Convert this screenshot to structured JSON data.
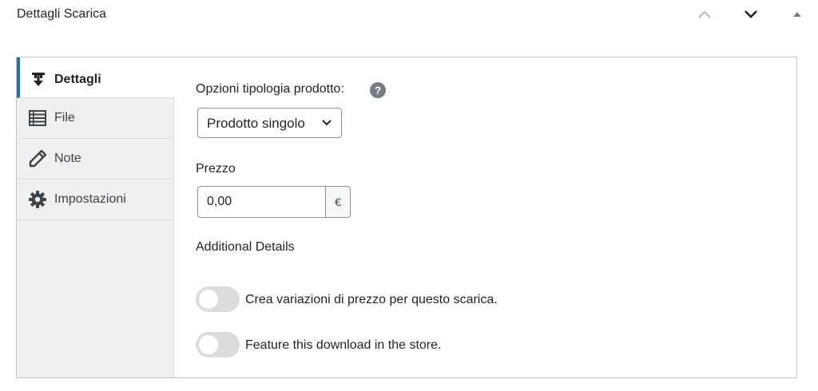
{
  "metabox": {
    "title": "Dettagli Scarica",
    "controls": {
      "move_up_icon": "chevron-up-icon",
      "move_down_icon": "chevron-down-icon",
      "toggle_icon": "triangle-up-icon"
    }
  },
  "sidebar": {
    "tabs": [
      {
        "label": "Dettagli",
        "icon": "download-arrow-icon",
        "active": true
      },
      {
        "label": "File",
        "icon": "list-icon",
        "active": false
      },
      {
        "label": "Note",
        "icon": "pencil-icon",
        "active": false
      },
      {
        "label": "Impostazioni",
        "icon": "gear-icon",
        "active": false
      }
    ]
  },
  "main": {
    "product_type": {
      "label": "Opzioni tipologia prodotto:",
      "selected": "Prodotto singolo"
    },
    "price": {
      "label": "Prezzo",
      "value": "0,00",
      "currency": "€"
    },
    "additional": {
      "heading": "Additional Details",
      "toggles": [
        {
          "label": "Crea variazioni di prezzo per questo scarica.",
          "enabled": false
        },
        {
          "label": "Feature this download in the store.",
          "enabled": false
        }
      ]
    }
  },
  "colors": {
    "accent": "#2271b1",
    "border": "#c3c4c7",
    "sidebar_bg": "#f0f0f1",
    "toggle_off": "#dcdcde"
  }
}
